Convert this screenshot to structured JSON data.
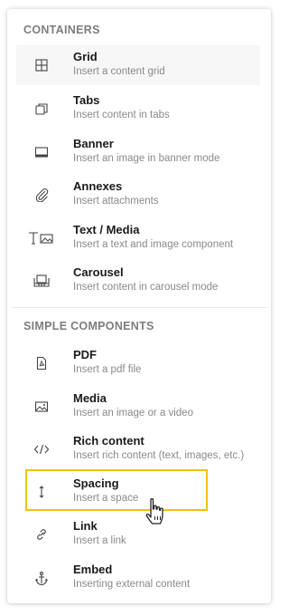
{
  "sections": [
    {
      "title": "CONTAINERS",
      "items": [
        {
          "label": "Grid",
          "description": "Insert a content grid",
          "icon": "grid-icon"
        },
        {
          "label": "Tabs",
          "description": "Insert content in tabs",
          "icon": "tabs-icon"
        },
        {
          "label": "Banner",
          "description": "Insert an image in banner mode",
          "icon": "banner-icon"
        },
        {
          "label": "Annexes",
          "description": "Insert attachments",
          "icon": "paperclip-icon"
        },
        {
          "label": "Text / Media",
          "description": "Insert a text and image component",
          "icon": "text-media-icon"
        },
        {
          "label": "Carousel",
          "description": "Insert content in carousel mode",
          "icon": "carousel-icon"
        }
      ]
    },
    {
      "title": "SIMPLE COMPONENTS",
      "items": [
        {
          "label": "PDF",
          "description": "Insert a pdf file",
          "icon": "pdf-icon"
        },
        {
          "label": "Media",
          "description": "Insert an image or a video",
          "icon": "image-icon"
        },
        {
          "label": "Rich content",
          "description": "Insert rich content (text, images, etc.)",
          "icon": "code-icon"
        },
        {
          "label": "Spacing",
          "description": "Insert a space",
          "icon": "spacing-icon"
        },
        {
          "label": "Link",
          "description": "Insert a link",
          "icon": "link-icon"
        },
        {
          "label": "Embed",
          "description": "Inserting external content",
          "icon": "anchor-icon"
        }
      ]
    }
  ],
  "highlighted_item": "Spacing",
  "colors": {
    "highlight_border": "#f0c20e",
    "hover_background": "#f7f7f7",
    "section_title": "#7d7d7d",
    "label": "#1a1a1a",
    "description": "#8a8a8a"
  }
}
